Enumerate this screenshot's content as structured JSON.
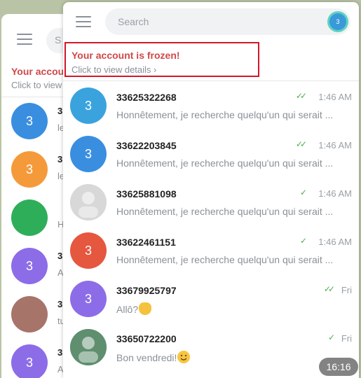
{
  "back_window": {
    "frozen_title": "Your accou",
    "frozen_sub": "Click to view",
    "rows": [
      {
        "avatar": "3",
        "color": "#3a8ee0",
        "name": "3",
        "msg": "le"
      },
      {
        "avatar": "3",
        "color": "#f59a3a",
        "name": "3",
        "msg": "le"
      },
      {
        "avatar": "",
        "color": "#2fae5a",
        "name": "",
        "msg": "H"
      },
      {
        "avatar": "3",
        "color": "#8d6ce8",
        "name": "3",
        "msg": "A"
      },
      {
        "avatar": "",
        "color": "#a7746a",
        "name": "3",
        "msg": "tu"
      },
      {
        "avatar": "3",
        "color": "#8d6ce8",
        "name": "3",
        "msg": "A"
      }
    ]
  },
  "search": {
    "placeholder": "Search"
  },
  "status_badge": {
    "label": "3"
  },
  "frozen": {
    "title": "Your account is frozen!",
    "subtitle": "Click to view details ›"
  },
  "chats": [
    {
      "name": "33625322268",
      "time": "1:46 AM",
      "check": "double",
      "msg": "Honnêtement, je recherche quelqu'un qui serait ...",
      "avatar": "3",
      "color": "#3aa3de"
    },
    {
      "name": "33622203845",
      "time": "1:46 AM",
      "check": "double",
      "msg": "Honnêtement, je recherche quelqu'un qui serait ...",
      "avatar": "3",
      "color": "#3a8ee0"
    },
    {
      "name": "33625881098",
      "time": "1:46 AM",
      "check": "single",
      "msg": "Honnêtement, je recherche quelqu'un qui serait ...",
      "avatar": "",
      "color": "#d8d8d8"
    },
    {
      "name": "33622461151",
      "time": "1:46 AM",
      "check": "single",
      "msg": "Honnêtement, je recherche quelqu'un qui serait ...",
      "avatar": "3",
      "color": "#e5573f"
    },
    {
      "name": "33679925797",
      "time": "Fri",
      "check": "double",
      "msg": "Allô?",
      "avatar": "3",
      "color": "#8d6ce8",
      "emoji": "wave-hand"
    },
    {
      "name": "33650722200",
      "time": "Fri",
      "check": "single",
      "msg": "Bon vendredi!",
      "avatar": "",
      "color": "#5f8f6f",
      "emoji": "smile"
    }
  ],
  "clock": "16:16",
  "colors": {
    "accent_green": "#4fae4e",
    "frozen_red": "#d0182a"
  }
}
